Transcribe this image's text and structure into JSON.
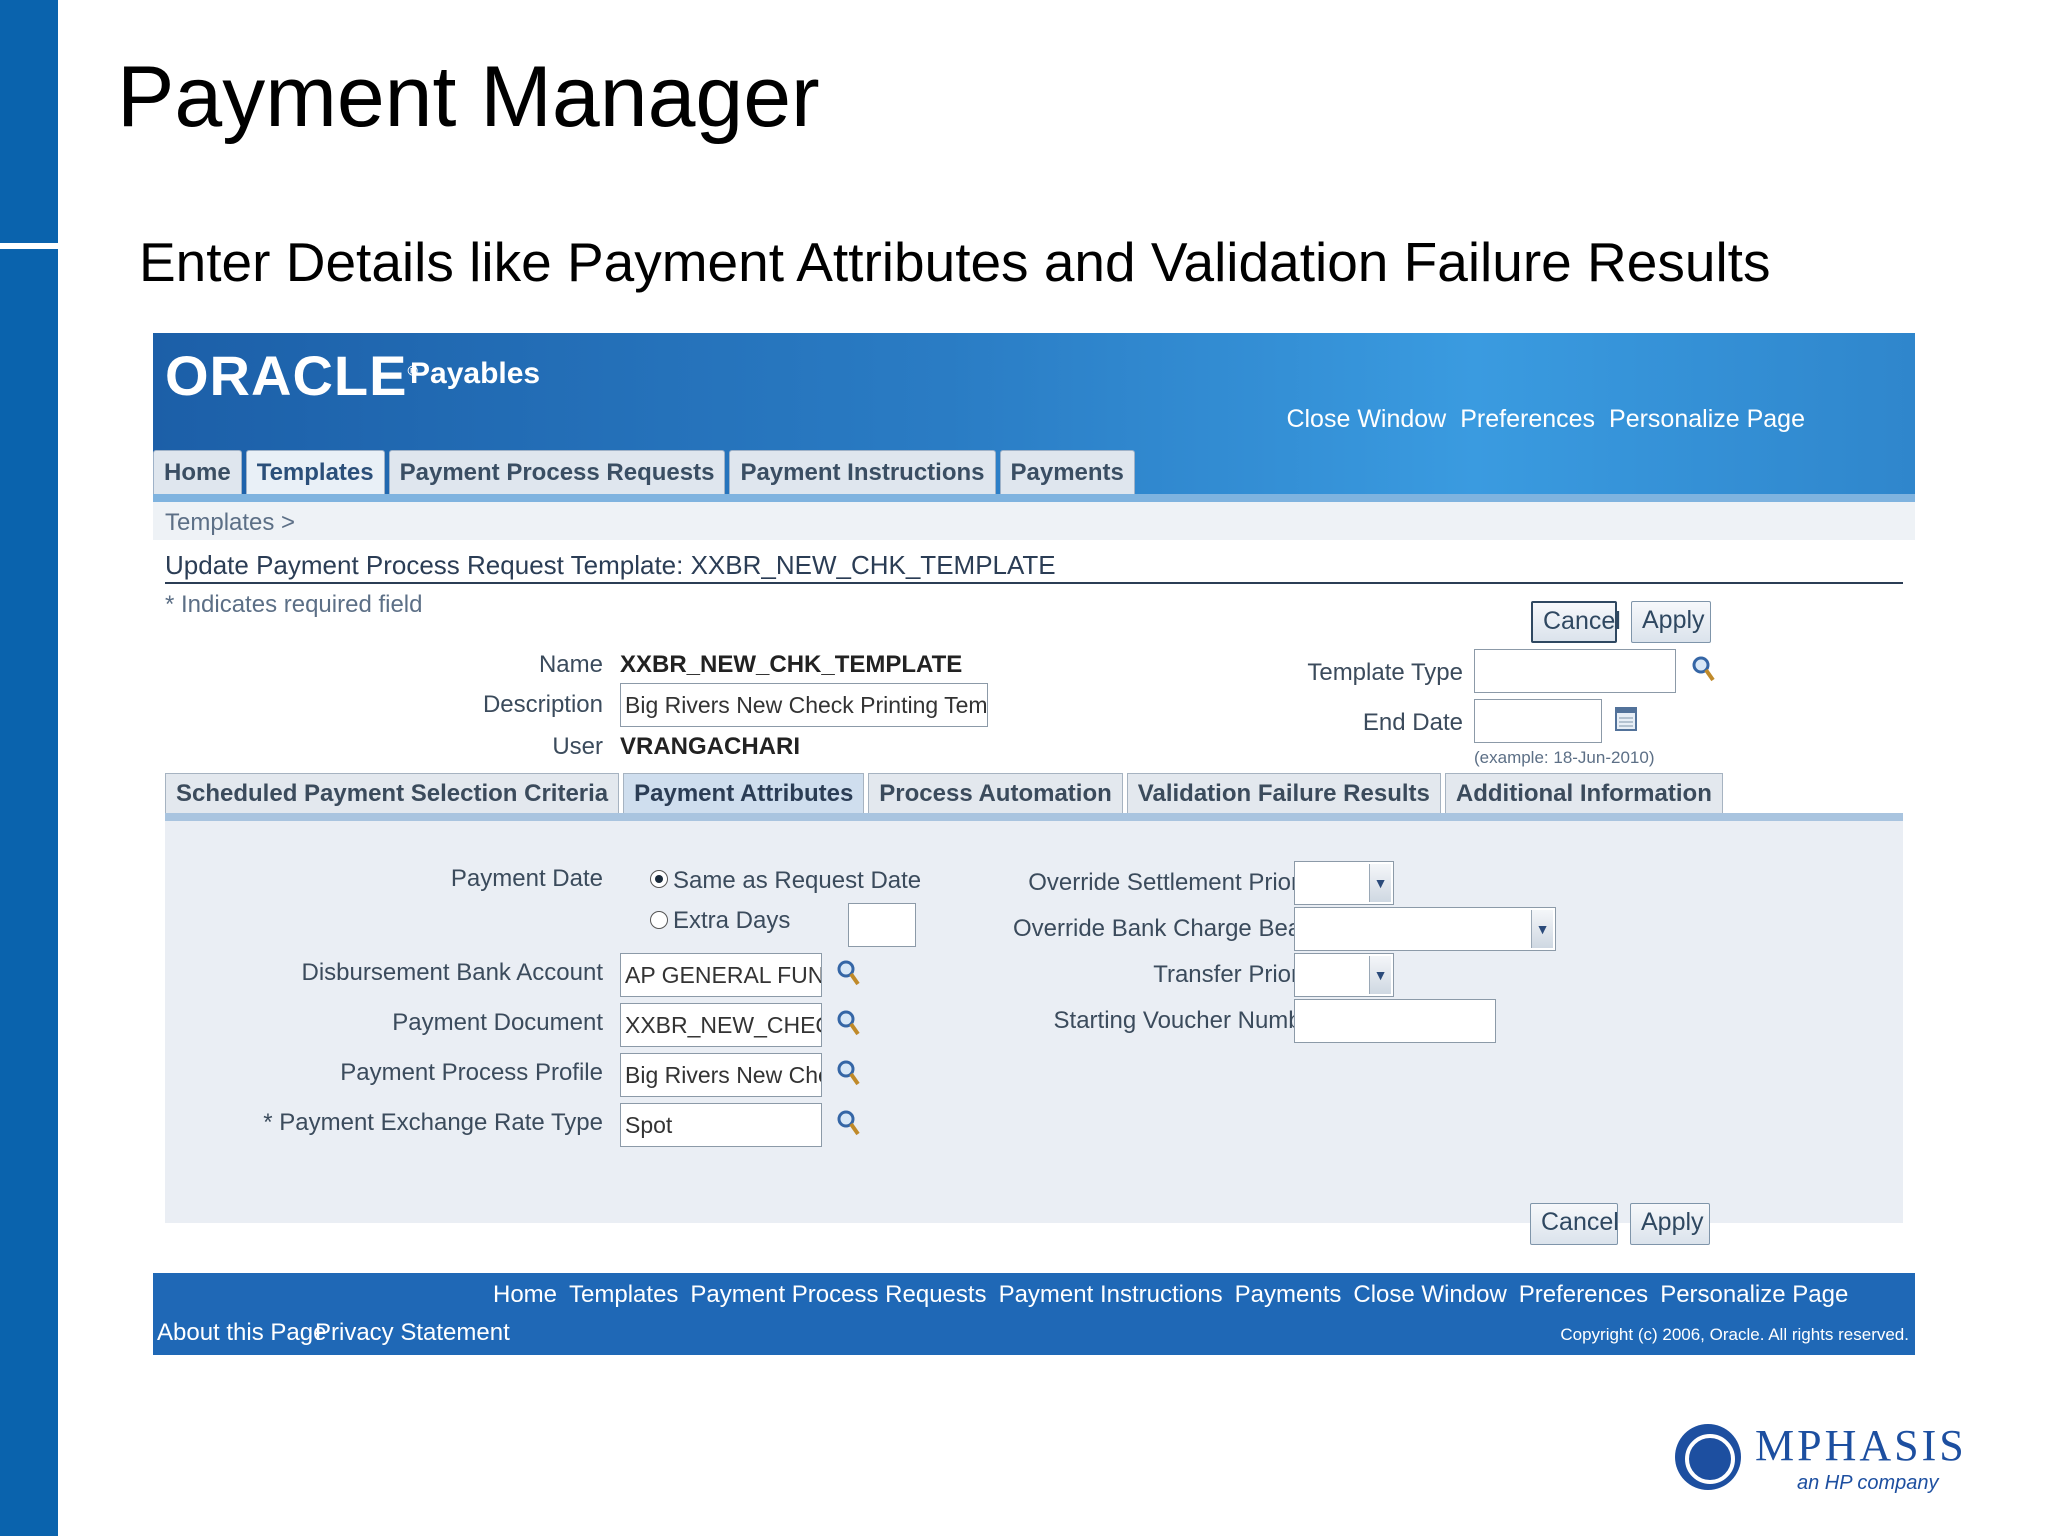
{
  "slide": {
    "title": "Payment Manager",
    "subtitle": "Enter Details like Payment Attributes and Validation Failure Results"
  },
  "app": {
    "logo": "ORACLE",
    "product": "Payables",
    "global_links": [
      "Close Window",
      "Preferences",
      "Personalize Page"
    ],
    "tabs": [
      "Home",
      "Templates",
      "Payment Process Requests",
      "Payment Instructions",
      "Payments"
    ],
    "active_tab": "Templates"
  },
  "page": {
    "breadcrumb": "Templates  >",
    "heading": "Update Payment Process Request Template: XXBR_NEW_CHK_TEMPLATE",
    "required_note": "* Indicates required field",
    "cancel_label": "Cancel",
    "apply_label": "Apply"
  },
  "form": {
    "name_label": "Name",
    "name_value": "XXBR_NEW_CHK_TEMPLATE",
    "description_label": "Description",
    "description_value": "Big Rivers New Check Printing Template",
    "user_label": "User",
    "user_value": "VRANGACHARI",
    "template_type_label": "Template Type",
    "template_type_value": "",
    "end_date_label": "End Date",
    "end_date_value": "",
    "end_date_hint": "(example: 18-Jun-2010)"
  },
  "subtabs": [
    "Scheduled Payment Selection Criteria",
    "Payment Attributes",
    "Process Automation",
    "Validation Failure Results",
    "Additional Information"
  ],
  "attributes": {
    "payment_date_label": "Payment Date",
    "radio_same": "Same as Request Date",
    "radio_extra": "Extra Days",
    "extra_days_value": "",
    "bank_account_label": "Disbursement Bank Account",
    "bank_account_value": "AP GENERAL FUND",
    "payment_document_label": "Payment Document",
    "payment_document_value": "XXBR_NEW_CHECK_TRI",
    "process_profile_label": "Payment Process Profile",
    "process_profile_value": "Big Rivers New Check Pr",
    "exchange_rate_label": "* Payment Exchange Rate Type",
    "exchange_rate_value": "Spot",
    "override_settlement_label": "Override Settlement Priority",
    "override_bank_charge_label": "Override Bank Charge Bearer",
    "transfer_priority_label": "Transfer Priority",
    "starting_voucher_label": "Starting Voucher Number",
    "starting_voucher_value": ""
  },
  "footer": {
    "links": [
      "Home",
      "Templates",
      "Payment Process Requests",
      "Payment Instructions",
      "Payments",
      "Close Window",
      "Preferences",
      "Personalize Page"
    ],
    "about": "About this Page",
    "privacy": "Privacy Statement",
    "copyright": "Copyright (c) 2006, Oracle. All rights reserved."
  },
  "brand": {
    "name": "MPHASIS",
    "tagline": "an HP company"
  }
}
